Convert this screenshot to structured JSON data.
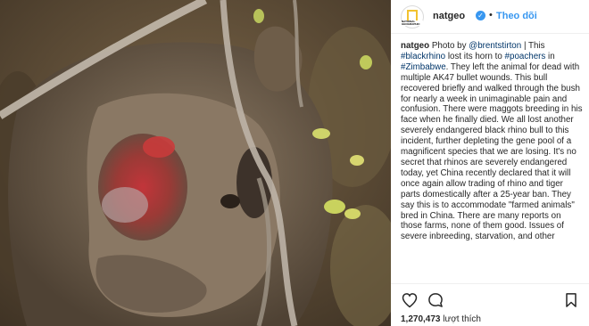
{
  "post": {
    "username": "natgeo",
    "verified_symbol": "✓",
    "separator": "•",
    "follow_label": "Theo dõi",
    "avatar_text": "NATIONAL GEOGRAPHIC"
  },
  "caption": {
    "username": "natgeo",
    "segments": [
      {
        "text": " Photo by ",
        "type": "text"
      },
      {
        "text": "@brentstirton",
        "type": "tag"
      },
      {
        "text": " | This ",
        "type": "text"
      },
      {
        "text": "#blackrhino",
        "type": "tag"
      },
      {
        "text": " lost its horn to ",
        "type": "text"
      },
      {
        "text": "#poachers",
        "type": "tag"
      },
      {
        "text": " in ",
        "type": "text"
      },
      {
        "text": "#Zimbabwe",
        "type": "tag"
      },
      {
        "text": ". They left the animal for dead with multiple AK47 bullet wounds. This bull recovered briefly and walked through the bush for nearly a week in unimaginable pain and confusion. There were maggots breeding in his face when he finally died. We all lost another severely endangered black rhino bull to this incident, further depleting the gene pool of a magnificent species that we are losing. It's no secret that rhinos are severely endangered today, yet China recently declared that it will once again allow trading of rhino and tiger parts domestically after a 25-year ban. They say this is to accommodate \"farmed animals\" bred in China. There are many reports on those farms, none of them good. Issues of severe inbreeding, starvation, and other",
        "type": "text"
      }
    ]
  },
  "actions": {
    "like_icon": "heart-icon",
    "comment_icon": "comment-icon",
    "save_icon": "bookmark-icon"
  },
  "likes": {
    "count": "1,270,473",
    "label": "lượt thích"
  },
  "colors": {
    "link": "#003569",
    "accent": "#3897f0",
    "text": "#262626"
  }
}
